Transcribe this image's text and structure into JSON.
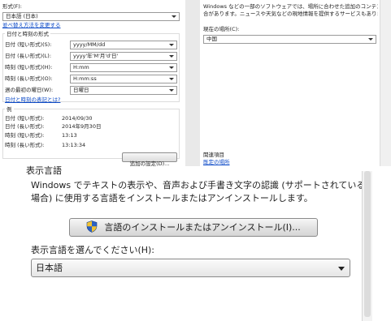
{
  "format_panel": {
    "format_label": "形式(F):",
    "format_value": "日本語 (日本)",
    "change_sort_link": "並べ替え方法を変更する",
    "group_title": "日付と時刻の形式",
    "rows": [
      {
        "label": "日付 (短い形式)(S):",
        "value": "yyyy/MM/dd"
      },
      {
        "label": "日付 (長い形式)(L):",
        "value": "yyyy'年'M'月'd'日'"
      },
      {
        "label": "時刻 (短い形式)(H):",
        "value": "H:mm"
      },
      {
        "label": "時刻 (長い形式)(O):",
        "value": "H:mm:ss"
      },
      {
        "label": "週の最初の曜日(W):",
        "value": "日曜日"
      }
    ],
    "notation_link": "日付と時刻の表記とは?",
    "example_title": "例",
    "examples": [
      {
        "label": "日付 (短い形式):",
        "value": "2014/09/30"
      },
      {
        "label": "日付 (長い形式):",
        "value": "2014年9月30日"
      },
      {
        "label": "時刻 (短い形式):",
        "value": "13:13"
      },
      {
        "label": "時刻 (長い形式):",
        "value": "13:13:34"
      }
    ],
    "additional_settings_button": "追加の設定(D)..."
  },
  "location_panel": {
    "description_line1": "Windows などの一部のソフトウェアでは、場所に合わせた追加のコンテンツが提供される",
    "description_line2": "合があります。ニュースや天気などの現地情報を提供するサービスもあります。",
    "location_label": "現在の場所(C):",
    "location_value": "中国",
    "related_title": "関連項目",
    "related_link": "既定の場所"
  },
  "language_panel": {
    "heading_fragment": "表示言語",
    "description_line1": "Windows でテキストの表示や、音声および手書き文字の認識 (サポートされている",
    "description_line2": "場合) に使用する言語をインストールまたはアンインストールします。",
    "install_button": "言語のインストールまたはアンインストール(I)...",
    "select_label": "表示言語を選んでください(H):",
    "select_value": "日本語"
  },
  "icons": {
    "install_button_icon": "uac-shield-icon",
    "dropdown_arrow": "chevron-down-icon"
  },
  "colors": {
    "link": "#0b49c7",
    "accent_scrollbar": "#4d86c7"
  }
}
